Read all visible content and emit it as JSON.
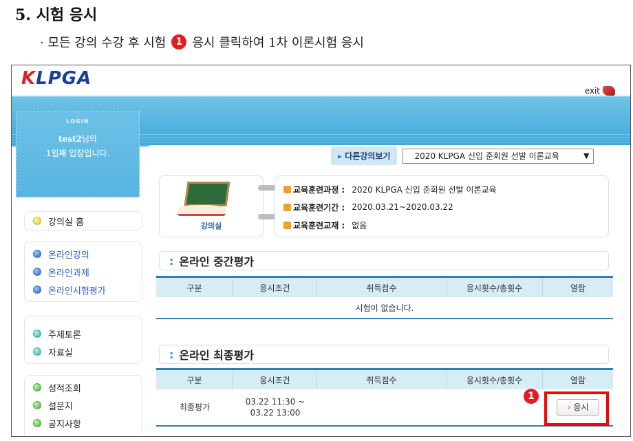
{
  "doc": {
    "title": "5. 시험 응시",
    "subtitle_before": "· 모든 강의 수강 후 시험",
    "subtitle_badge": "1",
    "subtitle_after": "응시 클릭하여 1차 이론시험 응시"
  },
  "app": {
    "logo_k": "K",
    "logo_rest": "LPGA",
    "exit_label": "exit"
  },
  "login": {
    "label": "LOGIN",
    "user_id": "test2",
    "user_suffix": "님의",
    "day_text": "1일째 입장입니다."
  },
  "sidebar": {
    "home": "강의실 홈",
    "group1": [
      "온라인강의",
      "온라인과제",
      "온라인시험평가"
    ],
    "group2": [
      "주제토론",
      "자료실"
    ],
    "group3": [
      "성적조회",
      "설문지",
      "공지사항"
    ]
  },
  "course_switch": {
    "label": "다른강의보기",
    "selected": "2020 KLPGA 신입 준회원 선발 이론교육"
  },
  "lecture_room": {
    "label": "강의실"
  },
  "course_info": {
    "rows": [
      {
        "key": "교육훈련과정 :",
        "value": "2020 KLPGA 신입 준회원 선발 이론교육"
      },
      {
        "key": "교육훈련기간 :",
        "value": "2020.03.21~2020.03.22"
      },
      {
        "key": "교육훈련교재 :",
        "value": "없음"
      }
    ]
  },
  "midterm": {
    "title": "온라인 중간평가",
    "headers": [
      "구분",
      "응시조건",
      "취득점수",
      "응시횟수/총횟수",
      "열람"
    ],
    "empty_text": "시험이 없습니다."
  },
  "final": {
    "title": "온라인 최종평가",
    "headers": [
      "구분",
      "응시조건",
      "취득점수",
      "응시횟수/총횟수",
      "열람"
    ],
    "row": {
      "type": "최종평가",
      "condition_line1": "03.22 11:30 ~",
      "condition_line2": "03.22 13:00",
      "score": "",
      "attempts": "",
      "button": "응시"
    },
    "marker": "1"
  },
  "colors": {
    "accent_red": "#e31b23",
    "banner_blue": "#3ea8d8",
    "table_blue": "#2b7fb8"
  }
}
